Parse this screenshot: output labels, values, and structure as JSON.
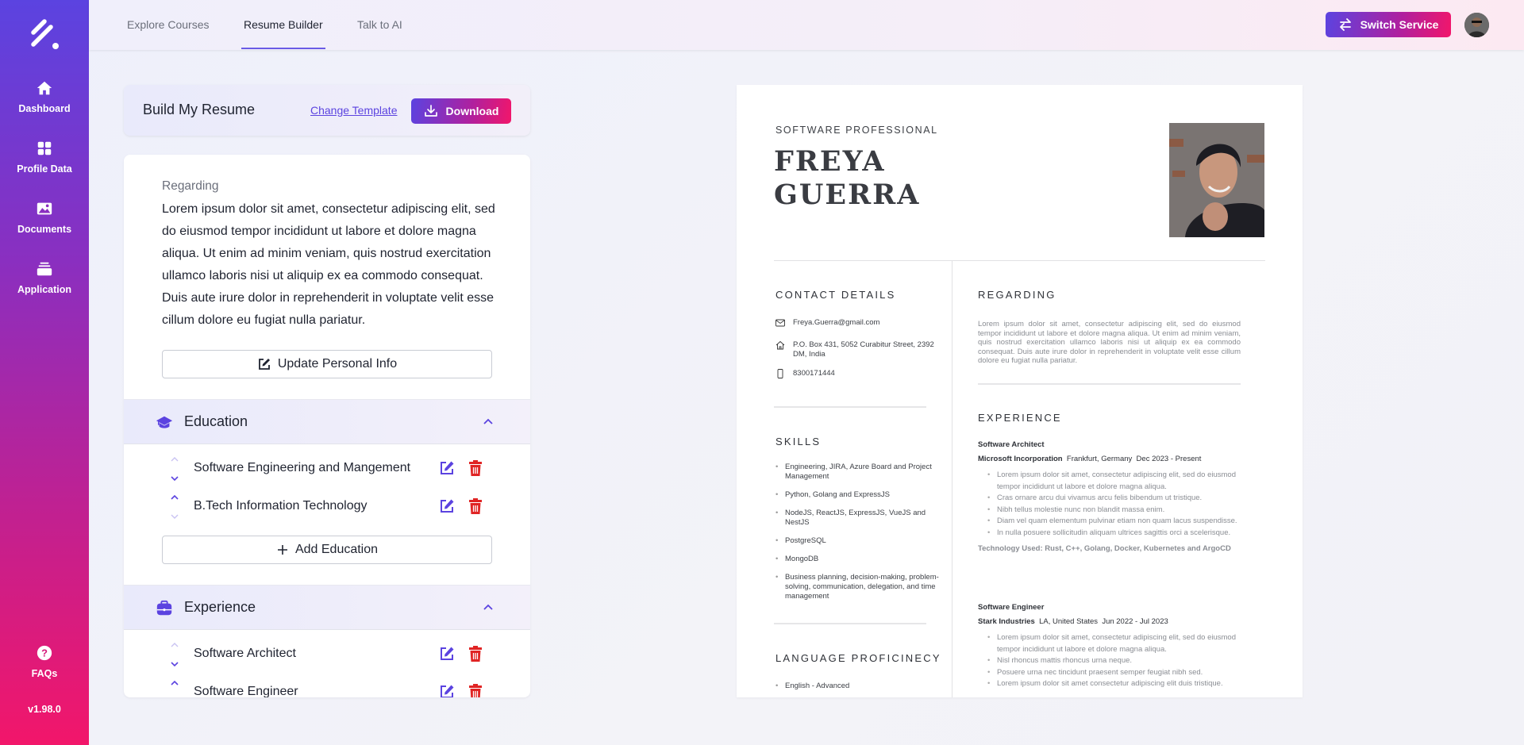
{
  "sidebar": {
    "items": [
      {
        "label": "Dashboard",
        "icon": "home-icon"
      },
      {
        "label": "Profile Data",
        "icon": "grid-icon"
      },
      {
        "label": "Documents",
        "icon": "image-icon"
      },
      {
        "label": "Application",
        "icon": "stack-icon"
      }
    ],
    "faq": {
      "label": "FAQs",
      "icon": "question-circle-icon"
    },
    "version": "v1.98.0"
  },
  "topnav": {
    "tabs": [
      {
        "label": "Explore Courses",
        "active": false
      },
      {
        "label": "Resume Builder",
        "active": true
      },
      {
        "label": "Talk to AI",
        "active": false
      }
    ],
    "switch_service": "Switch Service"
  },
  "builder": {
    "title": "Build My Resume",
    "change_template": "Change Template",
    "download": "Download",
    "regarding_label": "Regarding",
    "regarding_text": "Lorem ipsum dolor sit amet, consectetur adipiscing elit, sed do eiusmod tempor incididunt ut labore et dolore magna aliqua. Ut enim ad minim veniam, quis nostrud exercitation ullamco laboris nisi ut aliquip ex ea commodo consequat. Duis aute irure dolor in reprehenderit in voluptate velit esse cillum dolore eu fugiat nulla pariatur.",
    "update_personal_info": "Update Personal Info",
    "education": {
      "title": "Education",
      "entries": [
        "Software Engineering and Mangement",
        "B.Tech Information Technology"
      ],
      "add_label": "Add Education"
    },
    "experience": {
      "title": "Experience",
      "entries": [
        "Software Architect",
        "Software Engineer"
      ]
    }
  },
  "resume": {
    "profession": "SOFTWARE PROFESSIONAL",
    "first_name": "FREYA",
    "last_name": "GUERRA",
    "contact_heading": "CONTACT DETAILS",
    "email": "Freya.Guerra@gmail.com",
    "address": "P.O. Box 431, 5052 Curabitur Street, 2392 DM, India",
    "phone": "8300171444",
    "skills_heading": "SKILLS",
    "skills": [
      "Engineering, JIRA, Azure Board and Project Management",
      "Python, Golang and ExpressJS",
      "NodeJS, ReactJS, ExpressJS, VueJS and NestJS",
      "PostgreSQL",
      "MongoDB",
      "Business planning, decision-making, problem-solving, communication, delegation, and time management"
    ],
    "language_heading": "LANGUAGE PROFICINECY",
    "languages": [
      "English - Advanced"
    ],
    "regarding_heading": "REGARDING",
    "regarding_text": "Lorem ipsum dolor sit amet, consectetur adipiscing elit, sed do eiusmod tempor incididunt ut labore et dolore magna aliqua. Ut enim ad minim veniam, quis nostrud exercitation ullamco laboris nisi ut aliquip ex ea commodo consequat. Duis aute irure dolor in reprehenderit in voluptate velit esse cillum dolore eu fugiat nulla pariatur.",
    "experience_heading": "EXPERIENCE",
    "jobs": [
      {
        "title": "Software Architect",
        "company": "Microsoft Incorporation",
        "location": "Frankfurt, Germany",
        "dates": "Dec 2023 - Present",
        "bullets": [
          "Lorem ipsum dolor sit amet, consectetur adipiscing elit, sed do eiusmod tempor incididunt ut labore et dolore magna aliqua.",
          "Cras ornare arcu dui vivamus arcu felis bibendum ut tristique.",
          "Nibh tellus molestie nunc non blandit massa enim.",
          "Diam vel quam elementum pulvinar etiam non quam lacus suspendisse.",
          "In nulla posuere sollicitudin aliquam ultrices sagittis orci a scelerisque."
        ],
        "tech": "Technology Used: Rust, C++, Golang, Docker, Kubernetes and ArgoCD"
      },
      {
        "title": "Software Engineer",
        "company": "Stark Industries",
        "location": "LA, United States",
        "dates": "Jun 2022 - Jul 2023",
        "bullets": [
          "Lorem ipsum dolor sit amet, consectetur adipiscing elit, sed do eiusmod tempor incididunt ut labore et dolore magna aliqua.",
          "Nisl rhoncus mattis rhoncus urna neque.",
          "Posuere urna nec tincidunt praesent semper feugiat nibh sed.",
          "Lorem ipsum dolor sit amet consectetur adipiscing elit duis tristique."
        ]
      }
    ]
  },
  "colors": {
    "accent": "#5b43e0",
    "gradient_end": "#f2166a",
    "delete": "#e02424"
  }
}
